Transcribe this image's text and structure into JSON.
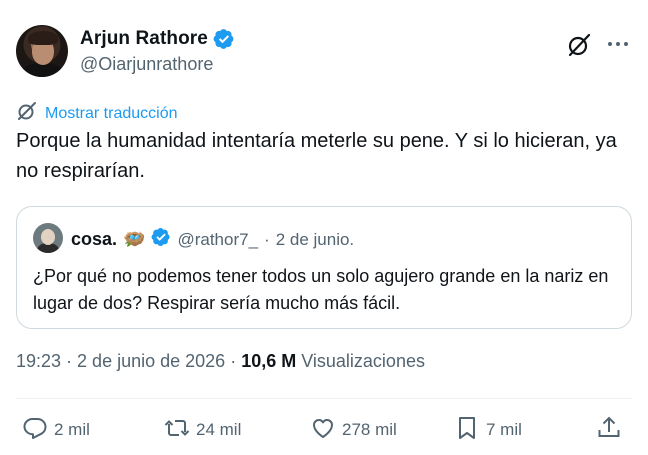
{
  "author": {
    "display_name": "Arjun Rathore",
    "handle": "@Oiarjunrathore"
  },
  "header_icons": [
    "verified-badge-icon",
    "grok-icon",
    "more-icon"
  ],
  "translate": {
    "label": "Mostrar traducción",
    "icon": "translate-icon"
  },
  "tweet": {
    "text": "Porque la humanidad intentaría meterle su pene. Y si lo hicieran, ya no respirarían."
  },
  "quote": {
    "display_name": "cosa.",
    "emoji": "🪺",
    "handle": "@rathor7_",
    "separator": "·",
    "date": "2 de junio.",
    "text": "¿Por qué no podemos tener todos un solo agujero grande en la nariz en lugar de dos? Respirar sería mucho más fácil."
  },
  "meta": {
    "time": "19:23",
    "sep1": "·",
    "date": "2 de junio de 2026",
    "sep2": "·",
    "views_count": "10,6 M",
    "views_label": "Visualizaciones"
  },
  "actions": {
    "replies": "2 mil",
    "reposts": "24 mil",
    "likes": "278 mil",
    "bookmarks": "7 mil"
  },
  "colors": {
    "accent": "#1d9bf0",
    "text": "#0f1419",
    "secondary": "#536471",
    "border": "#cfd9de"
  }
}
